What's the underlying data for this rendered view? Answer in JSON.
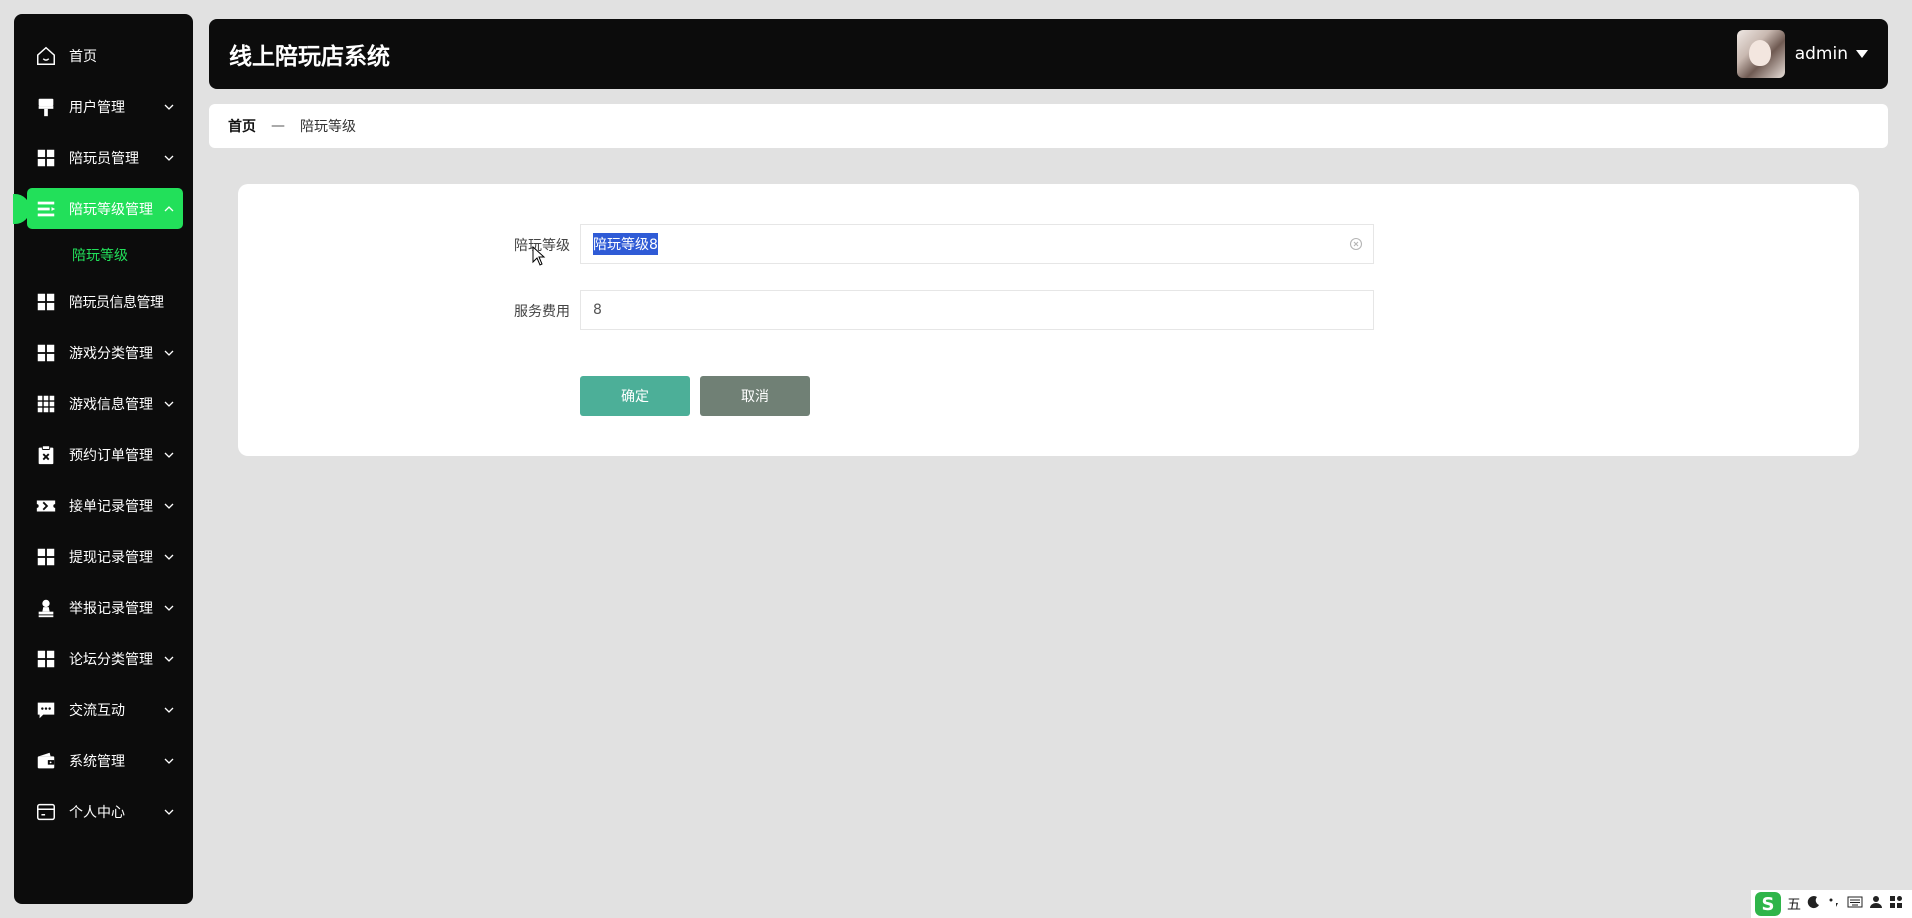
{
  "header": {
    "title": "线上陪玩店系统",
    "username": "admin"
  },
  "sidebar": {
    "items": [
      {
        "label": "首页",
        "icon": "home-icon"
      },
      {
        "label": "用户管理",
        "icon": "brush-icon"
      },
      {
        "label": "陪玩员管理",
        "icon": "grid-icon"
      },
      {
        "label": "陪玩等级管理",
        "icon": "list-icon",
        "active": true
      },
      {
        "label": "陪玩员信息管理",
        "icon": "grid-icon"
      },
      {
        "label": "游戏分类管理",
        "icon": "grid-icon"
      },
      {
        "label": "游戏信息管理",
        "icon": "apps-icon"
      },
      {
        "label": "预约订单管理",
        "icon": "clipboard-icon"
      },
      {
        "label": "接单记录管理",
        "icon": "ticket-icon"
      },
      {
        "label": "提现记录管理",
        "icon": "grid-icon"
      },
      {
        "label": "举报记录管理",
        "icon": "stamp-icon"
      },
      {
        "label": "论坛分类管理",
        "icon": "grid-icon"
      },
      {
        "label": "交流互动",
        "icon": "chat-icon"
      },
      {
        "label": "系统管理",
        "icon": "wallet-icon"
      },
      {
        "label": "个人中心",
        "icon": "card-icon"
      }
    ],
    "sub_item": "陪玩等级"
  },
  "breadcrumb": {
    "home": "首页",
    "separator": "—",
    "current": "陪玩等级"
  },
  "form": {
    "level_label": "陪玩等级",
    "level_value": "陪玩等级8",
    "fee_label": "服务费用",
    "fee_value": "8",
    "confirm_label": "确定",
    "cancel_label": "取消"
  },
  "ime": {
    "logo": "S",
    "mode": "五"
  },
  "colors": {
    "accent": "#22e05a",
    "sidebar_bg": "#0c0c0c",
    "confirm": "#4caf98",
    "cancel": "#708075"
  }
}
